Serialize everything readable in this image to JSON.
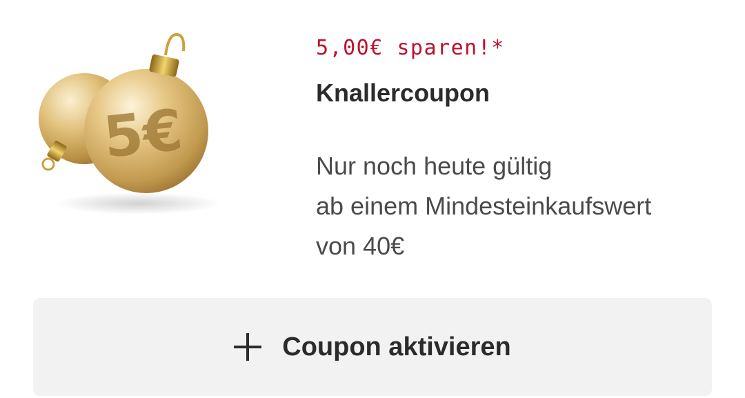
{
  "coupon": {
    "image": {
      "icon": "christmas-ornament-5-euro",
      "ornament_text": "5€"
    },
    "savings_label": "5,00€ sparen!*",
    "title": "Knallercoupon",
    "description_lines": [
      "Nur noch heute gültig",
      "ab einem Mindesteinkaufswert",
      "von 40€"
    ],
    "activate_button": {
      "icon": "plus-icon",
      "label": "Coupon aktivieren"
    },
    "colors": {
      "savings": "#c0102c",
      "title": "#2b2b2b",
      "description": "#4a4a4a",
      "button_background": "#f2f2f2",
      "ornament_gold": "#d4ad5e"
    }
  }
}
